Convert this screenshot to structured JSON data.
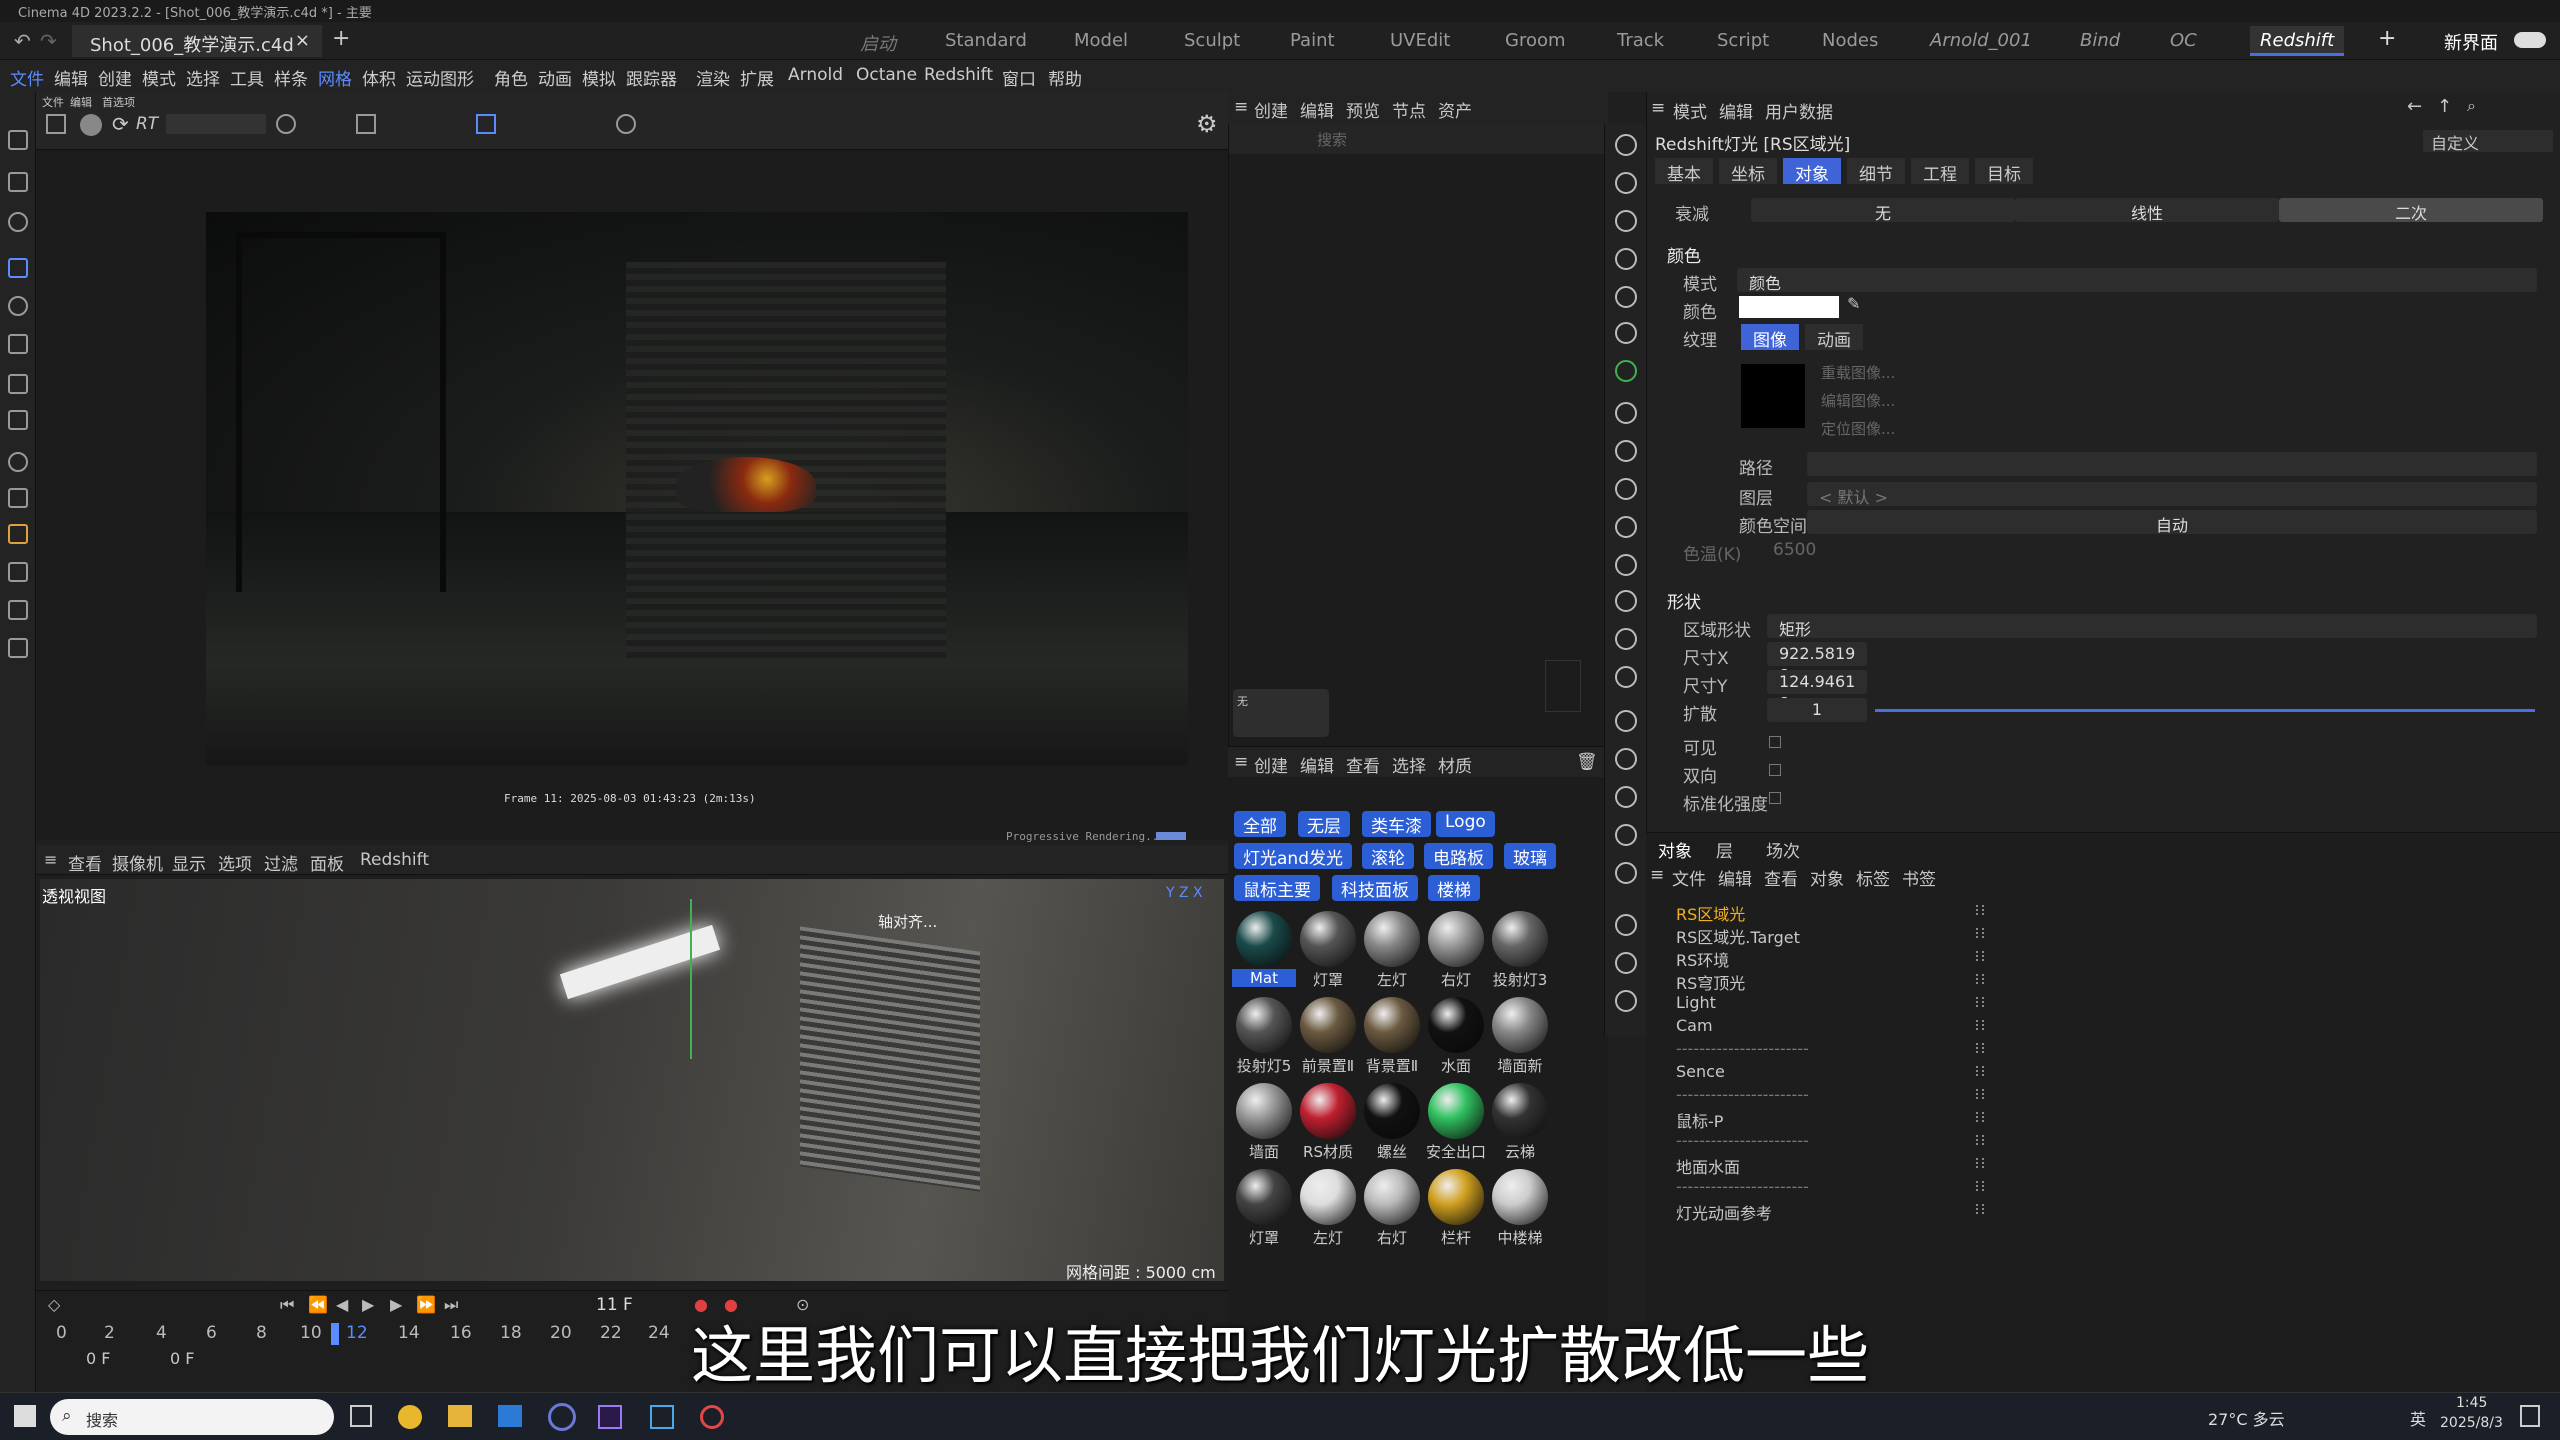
{
  "window_title": "Cinema 4D 2023.2.2 - [Shot_006_教学演示.c4d *] - 主要",
  "doc_tab": "Shot_006_教学演示.c4d *",
  "layouts": [
    "启动",
    "Standard",
    "Model",
    "Sculpt",
    "Paint",
    "UVEdit",
    "Groom",
    "Track",
    "Script",
    "Nodes",
    "Arnold_001",
    "Bind",
    "OC",
    "Redshift"
  ],
  "new_ui": "新界面",
  "menus": [
    "文件",
    "编辑",
    "创建",
    "模式",
    "选择",
    "工具",
    "样条",
    "网格",
    "体积",
    "运动图形",
    "角色",
    "动画",
    "模拟",
    "跟踪器",
    "渲染",
    "扩展",
    "Arnold",
    "Octane",
    "Redshift",
    "窗口",
    "帮助"
  ],
  "rv_menu": [
    "文件",
    "编辑",
    "首选项"
  ],
  "rv_caption": "Frame  11:  2025-08-03  01:43:23  (2m:13s)",
  "rv_status": "Progressive Rendering...",
  "viewport": {
    "menu": [
      "查看",
      "摄像机",
      "显示",
      "选项",
      "过滤",
      "面板",
      "Redshift"
    ],
    "label": "透视视图",
    "grid": "网格间距 : 5000 cm",
    "align_tip": "轴对齐..."
  },
  "timeline": {
    "frame": "11 F",
    "ticks": [
      "0",
      "2",
      "4",
      "6",
      "8",
      "10",
      "12",
      "14",
      "16",
      "18",
      "20",
      "22",
      "24"
    ],
    "start": "0 F",
    "end": "0 F"
  },
  "objmgr": {
    "menu": [
      "创建",
      "编辑",
      "预览",
      "节点",
      "资产"
    ],
    "search": "搜索",
    "none": "无"
  },
  "matpanel": {
    "menu": [
      "创建",
      "编辑",
      "查看",
      "选择",
      "材质"
    ],
    "chips": [
      "全部",
      "无层",
      "类车漆",
      "Logo",
      "灯光and发光",
      "滚轮",
      "电路板",
      "玻璃",
      "鼠标主要",
      "科技面板",
      "楼梯"
    ],
    "materials": [
      "Mat",
      "灯罩",
      "左灯",
      "右灯",
      "投射灯3",
      "投射灯5",
      "前景置Ⅱ",
      "背景置Ⅱ",
      "水面",
      "墙面新",
      "墙面",
      "RS材质",
      "螺丝",
      "安全出口",
      "云梯",
      "灯罩",
      "左灯",
      "右灯",
      "栏杆",
      "中楼梯"
    ]
  },
  "attr": {
    "menu": [
      "模式",
      "编辑",
      "用户数据"
    ],
    "title": "Redshift灯光 [RS区域光]",
    "custom": "自定义",
    "tabs": [
      "基本",
      "坐标",
      "对象",
      "细节",
      "工程",
      "目标"
    ],
    "falloff": {
      "label": "衰减",
      "opts": [
        "无",
        "线性",
        "二次"
      ]
    },
    "color_section": "颜色",
    "mode_label": "模式",
    "mode_val": "颜色",
    "color_label": "颜色",
    "texture_label": "纹理",
    "tex_tabs": [
      "图像",
      "动画"
    ],
    "tex_btns": [
      "重载图像...",
      "编辑图像...",
      "定位图像..."
    ],
    "path": "路径",
    "layer": "图层",
    "layer_val": "< 默认 >",
    "cspace": "颜色空间",
    "cspace_val": "自动",
    "temp": "色温(K)",
    "temp_val": "6500",
    "shape_section": "形状",
    "shape_label": "区域形状",
    "shape_val": "矩形",
    "sx": "尺寸X",
    "sx_val": "922.5819 c",
    "sy": "尺寸Y",
    "sy_val": "124.9461 c",
    "spread": "扩散",
    "spread_val": "1",
    "spread_fraction": 1.0,
    "visible": "可见",
    "double": "双向",
    "normalize": "标准化强度"
  },
  "scene": {
    "tabs": [
      "对象",
      "层",
      "场次"
    ],
    "menu": [
      "文件",
      "编辑",
      "查看",
      "对象",
      "标签",
      "书签"
    ],
    "items": [
      "RS区域光",
      "RS区域光.Target",
      "RS环境",
      "RS穹顶光",
      "Light",
      "Cam",
      "-----------------------",
      "Sence",
      "-----------------------",
      "鼠标-P",
      "-----------------------",
      "地面水面",
      "-----------------------",
      "灯光动画参考"
    ]
  },
  "taskbar": {
    "search": "搜索",
    "weather": "27°C 多云",
    "lang": "英",
    "time": "1:45",
    "date": "2025/8/3"
  },
  "subtitle": "这里我们可以直接把我们灯光扩散改低一些"
}
